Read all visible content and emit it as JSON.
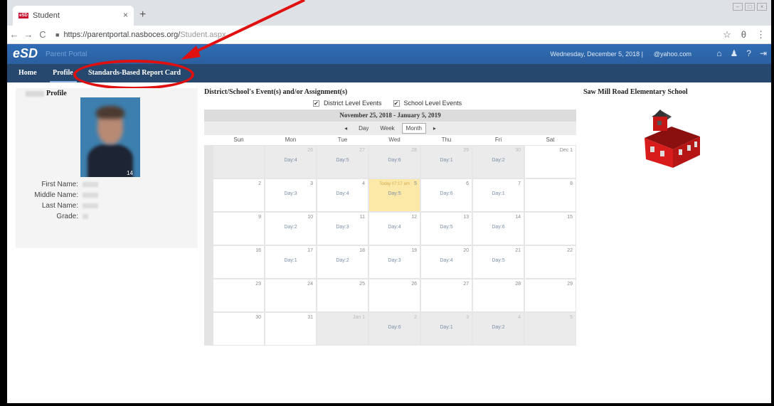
{
  "browser": {
    "tab_title": "Student",
    "tab_close": "×",
    "new_tab": "+",
    "url_host": "https://parentportal.nasboces.org/",
    "url_path": "Student.aspx",
    "nav_back": "←",
    "nav_forward": "→",
    "nav_reload": "C",
    "lock": "🔒",
    "star": "☆",
    "account": "θ",
    "menu": "⋮"
  },
  "app": {
    "logo": "eSD",
    "logo_sub": "Parent Portal",
    "date": "Wednesday, December 5, 2018  |",
    "email": "@yahoo.com",
    "icons": [
      "home-icon",
      "user-icon",
      "help-icon",
      "logout-icon"
    ]
  },
  "nav": {
    "home": "Home",
    "profile": "Profile",
    "report_card": "Standards-Based Report Card"
  },
  "profile": {
    "title": "Profile",
    "photo_num": "14",
    "fields": [
      {
        "label": "First Name:"
      },
      {
        "label": "Middle Name:"
      },
      {
        "label": "Last Name:"
      },
      {
        "label": "Grade:"
      }
    ]
  },
  "calendar": {
    "heading": "District/School's Event(s) and/or Assignment(s)",
    "filters": [
      {
        "label": "District Level Events",
        "checked": true
      },
      {
        "label": "School Level Events",
        "checked": true
      }
    ],
    "range": "November 25, 2018 - January 5, 2019",
    "views": {
      "prev": "◂",
      "day": "Day",
      "week": "Week",
      "month": "Month",
      "next": "▸"
    },
    "dow": [
      "Sun",
      "Mon",
      "Tue",
      "Wed",
      "Thu",
      "Fri",
      "Sat"
    ],
    "today_label": "Today 07:17 am",
    "weeks": [
      [
        {
          "d": "",
          "dim": true
        },
        {
          "d": "26",
          "dim": true,
          "evt": "Day:4"
        },
        {
          "d": "27",
          "dim": true,
          "evt": "Day:5"
        },
        {
          "d": "28",
          "dim": true,
          "evt": "Day:6"
        },
        {
          "d": "29",
          "dim": true,
          "evt": "Day:1"
        },
        {
          "d": "30",
          "dim": true,
          "evt": "Day:2"
        },
        {
          "d": "Dec 1"
        }
      ],
      [
        {
          "d": "2"
        },
        {
          "d": "3",
          "evt": "Day:3"
        },
        {
          "d": "4",
          "evt": "Day:4"
        },
        {
          "d": "5",
          "today": true,
          "evt": "Day:5"
        },
        {
          "d": "6",
          "evt": "Day:6"
        },
        {
          "d": "7",
          "evt": "Day:1"
        },
        {
          "d": "8"
        }
      ],
      [
        {
          "d": "9"
        },
        {
          "d": "10",
          "evt": "Day:2"
        },
        {
          "d": "11",
          "evt": "Day:3"
        },
        {
          "d": "12",
          "evt": "Day:4"
        },
        {
          "d": "13",
          "evt": "Day:5"
        },
        {
          "d": "14",
          "evt": "Day:6"
        },
        {
          "d": "15"
        }
      ],
      [
        {
          "d": "16"
        },
        {
          "d": "17",
          "evt": "Day:1"
        },
        {
          "d": "18",
          "evt": "Day:2"
        },
        {
          "d": "19",
          "evt": "Day:3"
        },
        {
          "d": "20",
          "evt": "Day:4"
        },
        {
          "d": "21",
          "evt": "Day:5"
        },
        {
          "d": "22"
        }
      ],
      [
        {
          "d": "23"
        },
        {
          "d": "24"
        },
        {
          "d": "25"
        },
        {
          "d": "26"
        },
        {
          "d": "27"
        },
        {
          "d": "28"
        },
        {
          "d": "29"
        }
      ],
      [
        {
          "d": "30"
        },
        {
          "d": "31"
        },
        {
          "d": "Jan 1",
          "dim": true
        },
        {
          "d": "2",
          "dim": true,
          "evt": "Day:6"
        },
        {
          "d": "3",
          "dim": true,
          "evt": "Day:1"
        },
        {
          "d": "4",
          "dim": true,
          "evt": "Day:2"
        },
        {
          "d": "5",
          "dim": true
        }
      ]
    ]
  },
  "school": {
    "title": "Saw Mill Road Elementary School"
  },
  "colors": {
    "header_blue": "#2f6db5",
    "nav_navy": "#26476e",
    "annotation_red": "#e01010",
    "today": "#fce9a8"
  }
}
